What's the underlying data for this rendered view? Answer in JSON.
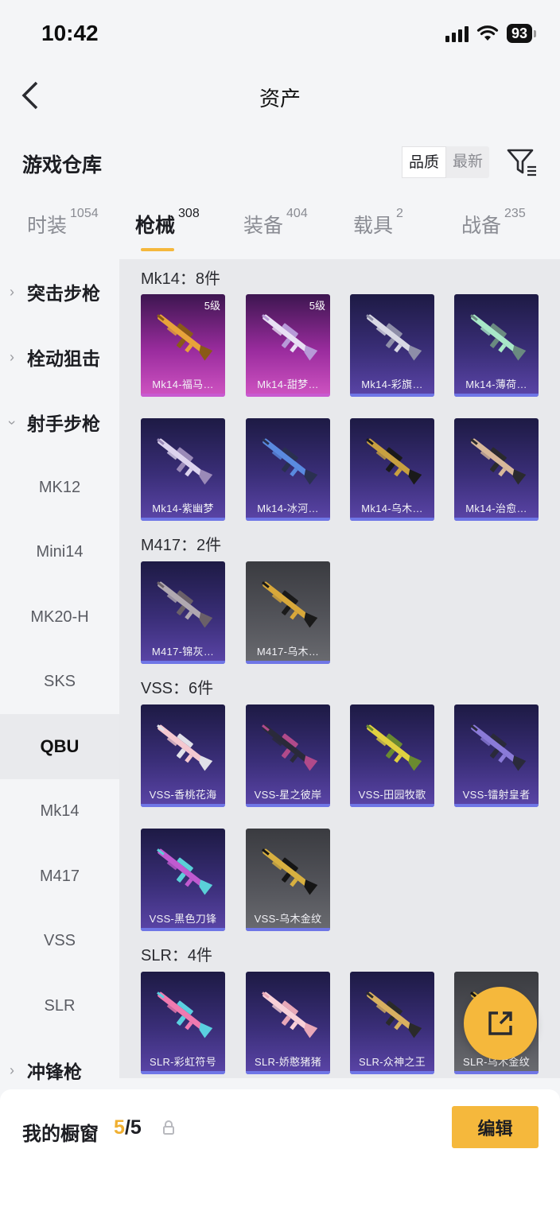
{
  "status_bar": {
    "time": "10:42",
    "battery": "93"
  },
  "nav": {
    "title": "资产"
  },
  "header": {
    "title": "游戏仓库",
    "sort_quality": "品质",
    "sort_newest": "最新"
  },
  "tabs": [
    {
      "label": "时装",
      "count": "1054"
    },
    {
      "label": "枪械",
      "count": "308"
    },
    {
      "label": "装备",
      "count": "404"
    },
    {
      "label": "载具",
      "count": "2"
    },
    {
      "label": "战备",
      "count": "235"
    }
  ],
  "sidebar": {
    "groups": [
      "突击步枪",
      "栓动狙击",
      "射手步枪",
      "冲锋枪"
    ],
    "items": [
      "MK12",
      "Mini14",
      "MK20-H",
      "SKS",
      "QBU",
      "Mk14",
      "M417",
      "VSS",
      "SLR"
    ],
    "selected": "QBU"
  },
  "sections": [
    {
      "label": "Mk14：8件",
      "cards": [
        {
          "name": "Mk14-福马…",
          "level": "5级",
          "style": "pink",
          "colors": [
            "#e8a33a",
            "#8a5a18"
          ]
        },
        {
          "name": "Mk14-甜梦…",
          "level": "5级",
          "style": "pink",
          "colors": [
            "#e8e0f4",
            "#b79ad8"
          ]
        },
        {
          "name": "Mk14-彩旗…",
          "level": "",
          "style": "purple",
          "colors": [
            "#d8d8e4",
            "#8e8ea8"
          ]
        },
        {
          "name": "Mk14-薄荷…",
          "level": "",
          "style": "purple",
          "colors": [
            "#a8e8c8",
            "#6a8a80"
          ]
        },
        {
          "name": "Mk14-紫幽梦",
          "level": "",
          "style": "purple",
          "colors": [
            "#ddd4ee",
            "#9a8ab8"
          ]
        },
        {
          "name": "Mk14-冰河…",
          "level": "",
          "style": "purple",
          "colors": [
            "#5a8ae0",
            "#2a3050"
          ]
        },
        {
          "name": "Mk14-乌木…",
          "level": "",
          "style": "purple",
          "colors": [
            "#c8a040",
            "#1a1a1a"
          ]
        },
        {
          "name": "Mk14-治愈…",
          "level": "",
          "style": "purple",
          "colors": [
            "#d8b89a",
            "#2a2a2e"
          ]
        }
      ]
    },
    {
      "label": "M417：2件",
      "cards": [
        {
          "name": "M417-锦灰…",
          "level": "",
          "style": "purple",
          "colors": [
            "#b0a8b0",
            "#6a6068"
          ]
        },
        {
          "name": "M417-乌木…",
          "level": "",
          "style": "gray",
          "colors": [
            "#d8a83a",
            "#1a1a1a"
          ]
        }
      ]
    },
    {
      "label": "VSS：6件",
      "cards": [
        {
          "name": "VSS-香桃花海",
          "level": "",
          "style": "purple",
          "colors": [
            "#f4c8d0",
            "#e0e0e8"
          ]
        },
        {
          "name": "VSS-星之彼岸",
          "level": "",
          "style": "purple",
          "colors": [
            "#2a2a3a",
            "#b04a8a"
          ]
        },
        {
          "name": "VSS-田园牧歌",
          "level": "",
          "style": "purple",
          "colors": [
            "#e0d040",
            "#6a8a30"
          ]
        },
        {
          "name": "VSS-镭射皇者",
          "level": "",
          "style": "purple",
          "colors": [
            "#8a7ad8",
            "#2a2a3a"
          ]
        },
        {
          "name": "VSS-黑色刀锋",
          "level": "",
          "style": "purple",
          "colors": [
            "#c05ad0",
            "#5ad0d8"
          ]
        },
        {
          "name": "VSS-乌木金纹",
          "level": "",
          "style": "gray",
          "colors": [
            "#d8b040",
            "#151515"
          ]
        }
      ]
    },
    {
      "label": "SLR：4件",
      "cards": [
        {
          "name": "SLR-彩虹符号",
          "level": "",
          "style": "purple",
          "colors": [
            "#f07ab0",
            "#5ad0e0"
          ]
        },
        {
          "name": "SLR-娇憨猪猪",
          "level": "",
          "style": "purple",
          "colors": [
            "#f8d0d8",
            "#e8a8b8"
          ]
        },
        {
          "name": "SLR-众神之王",
          "level": "",
          "style": "purple",
          "colors": [
            "#d8b060",
            "#2a2a2a"
          ]
        },
        {
          "name": "SLR-乌木金纹",
          "level": "",
          "style": "gray",
          "colors": [
            "#d8b040",
            "#151515"
          ]
        }
      ]
    }
  ],
  "bottom": {
    "label": "我的橱窗",
    "current": "5",
    "total": "/5",
    "edit": "编辑"
  },
  "colors": {
    "accent": "#f5b83c",
    "card_bar": "#6f76e6"
  }
}
